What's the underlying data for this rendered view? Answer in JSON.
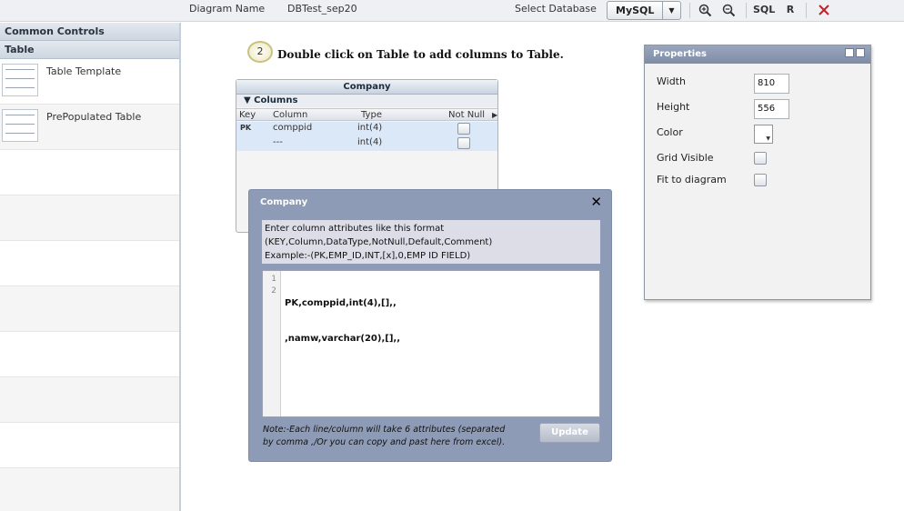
{
  "toolbar": {
    "diagram_name_label": "Diagram Name",
    "diagram_name_value": "DBTest_sep20",
    "select_db_label": "Select Database",
    "db_selected": "MySQL",
    "sql_label": "SQL",
    "r_label": "R",
    "icons": [
      "zoom-in-icon",
      "zoom-out-icon",
      "close-icon"
    ],
    "close_color": "#c8202a"
  },
  "sidebar": {
    "sections": [
      {
        "label": "Common Controls"
      },
      {
        "label": "Table"
      }
    ],
    "items": [
      {
        "label": "Table Template"
      },
      {
        "label": "PrePopulated Table"
      }
    ]
  },
  "canvas": {
    "step_number": "2",
    "step_text": "Double click on Table to add columns to Table."
  },
  "table_widget": {
    "title": "Company",
    "section_label": "Columns",
    "headers": [
      "Key",
      "Column",
      "Type",
      "Not Null"
    ],
    "rows": [
      {
        "key": "PK",
        "column": "comppid",
        "type": "int(4)"
      },
      {
        "key": "",
        "column": "---",
        "type": "int(4)"
      }
    ]
  },
  "modal": {
    "title": "Company",
    "instructions": [
      "Enter column attributes like this format",
      "(KEY,Column,DataType,NotNull,Default,Comment)",
      "Example:-(PK,EMP_ID,INT,[x],0,EMP ID FIELD)"
    ],
    "line_numbers": [
      "1",
      "2"
    ],
    "code_lines": [
      "PK,comppid,int(4),[],,",
      ",namw,varchar(20),[],,"
    ],
    "note_lines": [
      "Note:-Each line/column will take 6 attributes (separated",
      "by comma ,/Or you can copy and past here from excel)."
    ],
    "update_label": "Update",
    "background_color": "#8e9bb6"
  },
  "properties": {
    "title": "Properties",
    "width_label": "Width",
    "width_value": "810",
    "height_label": "Height",
    "height_value": "556",
    "color_label": "Color",
    "grid_label": "Grid Visible",
    "fit_label": "Fit to diagram"
  }
}
